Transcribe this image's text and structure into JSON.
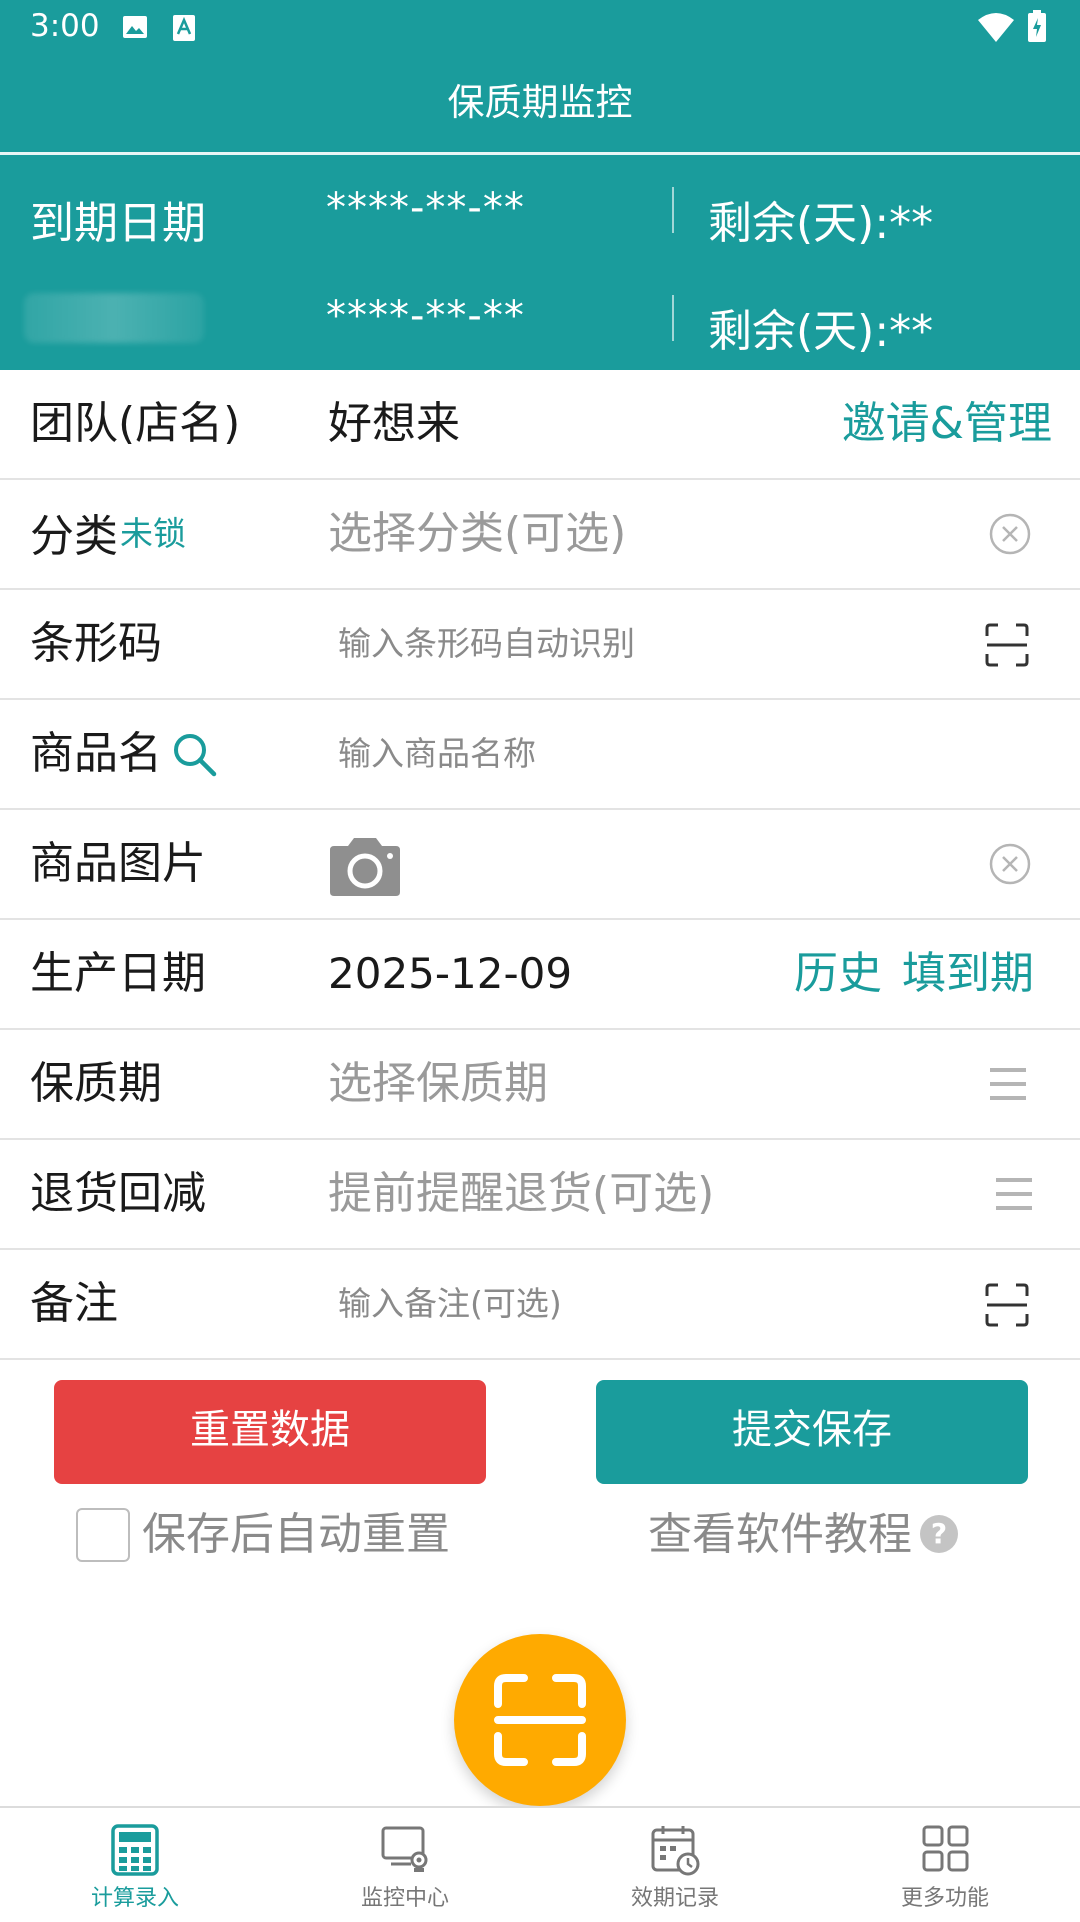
{
  "status_bar": {
    "time": "3:00",
    "icons": [
      "image-icon",
      "font-icon",
      "wifi-icon",
      "battery-icon"
    ]
  },
  "app_bar": {
    "title": "保质期监控"
  },
  "expiry_panel": {
    "rows": [
      {
        "label": "到期日期",
        "date": "****-**-**",
        "remaining": "剩余(天):**"
      },
      {
        "label": "",
        "date": "****-**-**",
        "remaining": "剩余(天):**"
      }
    ]
  },
  "form": {
    "team": {
      "label": "团队(店名)",
      "value": "好想来",
      "link": "邀请&管理"
    },
    "category": {
      "label": "分类",
      "tag": "未锁",
      "placeholder": "选择分类(可选)"
    },
    "barcode": {
      "label": "条形码",
      "placeholder": "输入条形码自动识别"
    },
    "product_name": {
      "label": "商品名",
      "placeholder": "输入商品名称"
    },
    "product_image": {
      "label": "商品图片"
    },
    "production_date": {
      "label": "生产日期",
      "value": "2025-12-09",
      "history_link": "历史",
      "fill_expiry_link": "填到期"
    },
    "shelf_life": {
      "label": "保质期",
      "placeholder": "选择保质期"
    },
    "return_reduce": {
      "label": "退货回减",
      "placeholder": "提前提醒退货(可选)"
    },
    "remark": {
      "label": "备注",
      "placeholder": "输入备注(可选)"
    }
  },
  "actions": {
    "reset_label": "重置数据",
    "submit_label": "提交保存",
    "auto_reset_label": "保存后自动重置",
    "auto_reset_checked": false,
    "tutorial_label": "查看软件教程",
    "help_glyph": "?"
  },
  "bottom_nav": {
    "items": [
      {
        "label": "计算录入",
        "icon": "calculator-icon",
        "active": true
      },
      {
        "label": "监控中心",
        "icon": "monitor-icon",
        "active": false
      },
      {
        "label": "效期记录",
        "icon": "calendar-clock-icon",
        "active": false
      },
      {
        "label": "更多功能",
        "icon": "grid-icon",
        "active": false
      }
    ]
  },
  "colors": {
    "primary": "#1a9c9c",
    "danger": "#e64242",
    "fab": "#ffaa00",
    "placeholder": "#9a9a9a"
  }
}
